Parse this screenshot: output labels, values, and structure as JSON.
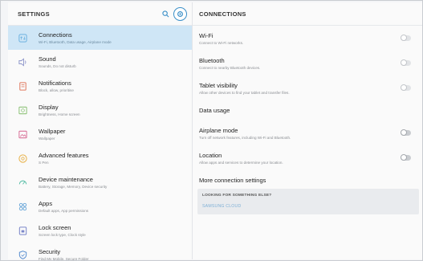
{
  "left": {
    "title": "SETTINGS",
    "items": [
      {
        "label": "Connections",
        "sub": "Wi-Fi, Bluetooth, Data usage, Airplane mode",
        "icon": "connections-icon",
        "active": true
      },
      {
        "label": "Sound",
        "sub": "Sounds, Do not disturb",
        "icon": "speaker-icon"
      },
      {
        "label": "Notifications",
        "sub": "Block, allow, prioritise",
        "icon": "notifications-icon"
      },
      {
        "label": "Display",
        "sub": "Brightness, Home screen",
        "icon": "display-icon"
      },
      {
        "label": "Wallpaper",
        "sub": "Wallpaper",
        "icon": "wallpaper-icon"
      },
      {
        "label": "Advanced features",
        "sub": "S Pen",
        "icon": "advanced-features-icon"
      },
      {
        "label": "Device maintenance",
        "sub": "Battery, Storage, Memory, Device security",
        "icon": "device-maintenance-icon"
      },
      {
        "label": "Apps",
        "sub": "Default apps, App permissions",
        "icon": "apps-icon"
      },
      {
        "label": "Lock screen",
        "sub": "Screen lock type, Clock style",
        "icon": "lock-icon"
      },
      {
        "label": "Security",
        "sub": "Find My Mobile, Secure Folder",
        "icon": "shield-icon"
      }
    ]
  },
  "right": {
    "title": "CONNECTIONS",
    "rows": [
      {
        "label": "Wi-Fi",
        "sub": "Connect to Wi-Fi networks.",
        "toggle": "light"
      },
      {
        "label": "Bluetooth",
        "sub": "Connect to nearby Bluetooth devices.",
        "toggle": "light"
      },
      {
        "label": "Tablet visibility",
        "sub": "Allow other devices to find your tablet and transfer files.",
        "toggle": "light"
      },
      {
        "label": "Data usage",
        "sub": "",
        "toggle": ""
      },
      {
        "label": "Airplane mode",
        "sub": "Turn off network features, including Wi-Fi and Bluetooth.",
        "toggle": "dark"
      },
      {
        "label": "Location",
        "sub": "Allow apps and services to determine your location.",
        "toggle": "dark"
      },
      {
        "label": "More connection settings",
        "sub": "",
        "toggle": ""
      }
    ],
    "looking": {
      "title": "LOOKING FOR SOMETHING ELSE?",
      "link": "SAMSUNG CLOUD"
    }
  },
  "colors": {
    "accent": "#3a8fc8",
    "active_bg": "#cfe6f6",
    "link": "#7fb0d6"
  }
}
